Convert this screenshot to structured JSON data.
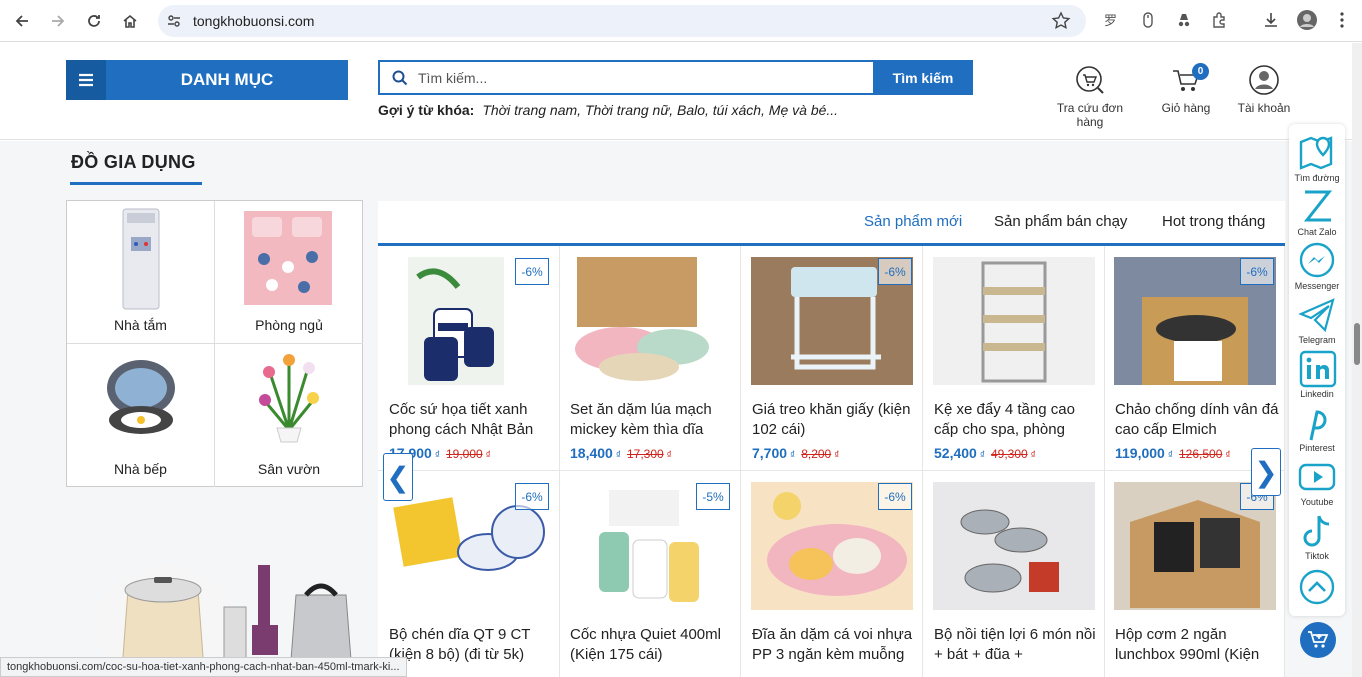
{
  "browser": {
    "url": "tongkhobuonsi.com"
  },
  "header": {
    "menu_label": "DANH MỤC",
    "search_placeholder": "Tìm kiếm...",
    "search_button": "Tìm kiếm",
    "suggest_label": "Gợi ý từ khóa:",
    "suggest_keywords": "Thời trang nam, Thời trang nữ, Balo, túi xách, Mẹ và bé...",
    "order_lookup": "Tra cứu đơn hàng",
    "cart": "Giỏ hàng",
    "cart_count": "0",
    "account": "Tài khoản"
  },
  "section": {
    "title": "ĐỒ GIA DỤNG",
    "categories": [
      "Nhà tắm",
      "Phòng ngủ",
      "Nhà bếp",
      "Sân vườn"
    ],
    "tabs": [
      "Sản phẩm mới",
      "Sản phẩm bán chạy",
      "Hot trong tháng"
    ],
    "arrow_prev": "❮",
    "arrow_next": "❯"
  },
  "products": [
    {
      "name": "Cốc sứ họa tiết xanh phong cách Nhật Bản",
      "price": "17,900",
      "old_price": "19,000",
      "discount": "-6%",
      "currency": "₫"
    },
    {
      "name": "Set ăn dặm lúa mạch mickey kèm thìa dĩa",
      "price": "18,400",
      "old_price": "17,300",
      "discount": "",
      "currency": "₫"
    },
    {
      "name": "Giá treo khăn giấy (kiện 102 cái)",
      "price": "7,700",
      "old_price": "8,200",
      "discount": "-6%",
      "currency": "₫"
    },
    {
      "name": "Kệ xe đẩy 4 tầng cao cấp cho spa, phòng",
      "price": "52,400",
      "old_price": "49,300",
      "discount": "",
      "currency": "₫"
    },
    {
      "name": "Chảo chống dính vân đá cao cấp Elmich",
      "price": "119,000",
      "old_price": "126,500",
      "discount": "-6%",
      "currency": "₫"
    },
    {
      "name": "Bộ chén dĩa QT 9 CT (kiện 8 bộ) (đi từ 5k)",
      "price": "",
      "old_price": "",
      "discount": "-6%",
      "currency": "₫"
    },
    {
      "name": "Cốc nhựa Quiet 400ml (Kiện 175 cái)",
      "price": "",
      "old_price": "",
      "discount": "-5%",
      "currency": "₫"
    },
    {
      "name": "Đĩa ăn dặm cá voi nhựa PP 3 ngăn kèm muỗng",
      "price": "",
      "old_price": "",
      "discount": "-6%",
      "currency": "₫"
    },
    {
      "name": "Bộ nồi tiện lợi 6 món nồi + bát + đũa +",
      "price": "",
      "old_price": "",
      "discount": "",
      "currency": "₫"
    },
    {
      "name": "Hộp cơm 2 ngăn lunchbox 990ml (Kiện",
      "price": "",
      "old_price": "",
      "discount": "-6%",
      "currency": "₫"
    }
  ],
  "sidebar": [
    {
      "label": "Tìm đường",
      "icon": "map-icon"
    },
    {
      "label": "Chat Zalo",
      "icon": "zalo-icon"
    },
    {
      "label": "Messenger",
      "icon": "messenger-icon"
    },
    {
      "label": "Telegram",
      "icon": "telegram-icon"
    },
    {
      "label": "Linkedin",
      "icon": "linkedin-icon"
    },
    {
      "label": "Pinterest",
      "icon": "pinterest-icon"
    },
    {
      "label": "Youtube",
      "icon": "youtube-icon"
    },
    {
      "label": "Tiktok",
      "icon": "tiktok-icon"
    }
  ],
  "status_url": "tongkhobuonsi.com/coc-su-hoa-tiet-xanh-phong-cach-nhat-ban-450ml-tmark-ki...",
  "colors": {
    "brand": "#1f6ebf",
    "old_price": "#d0251c"
  }
}
